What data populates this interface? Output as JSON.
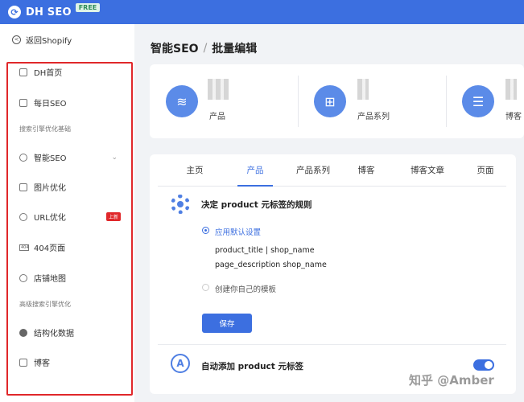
{
  "topbar": {
    "logo_text": "DH SEO",
    "free_badge": "FREE"
  },
  "sidebar": {
    "back_label": "返回Shopify",
    "items": [
      {
        "label": "DH首页"
      },
      {
        "label": "每日SEO"
      },
      {
        "label": "智能SEO"
      },
      {
        "label": "图片优化"
      },
      {
        "label": "URL优化",
        "badge": "上新"
      },
      {
        "label": "404页面",
        "tag": "404"
      },
      {
        "label": "店铺地图"
      },
      {
        "label": "结构化数据"
      },
      {
        "label": "博客"
      }
    ],
    "sections": [
      "搜索引擎优化基础",
      "高级搜索引擎优化"
    ]
  },
  "header": {
    "part1": "智能SEO",
    "sep": "/",
    "part2": "批量编辑"
  },
  "stats": [
    {
      "label": "产品"
    },
    {
      "label": "产品系列"
    },
    {
      "label": "博客"
    }
  ],
  "tabs": [
    "主页",
    "产品",
    "产品系列",
    "博客",
    "博客文章",
    "页面"
  ],
  "rule": {
    "title": "决定 product 元标签的规则",
    "option_default": "应用默认设置",
    "template_line1": "product_title | shop_name",
    "template_line2": "page_description shop_name",
    "option_custom": "创建你自己的模板",
    "save": "保存"
  },
  "auto": {
    "label": "自动添加 product 元标签",
    "enabled": true
  },
  "watermark": "知乎 @Amber",
  "colors": {
    "primary": "#3c6fe0",
    "highlight_frame": "#e0272a",
    "badge_red": "#e0272a"
  }
}
